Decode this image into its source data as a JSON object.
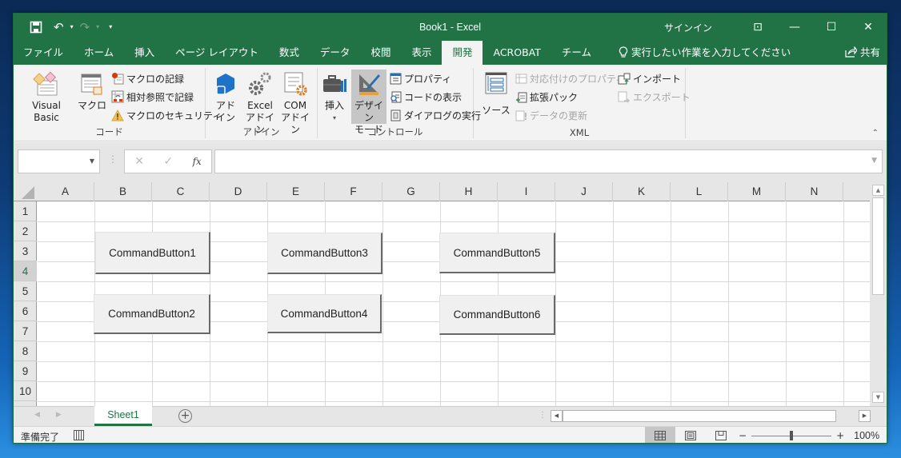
{
  "titlebar": {
    "title": "Book1  -  Excel",
    "signin": "サインイン",
    "qat": {
      "save": "save-icon",
      "undo": "undo-icon",
      "redo": "redo-icon",
      "customize": "customize-qat-icon"
    },
    "icons": {
      "save": "🖫",
      "undo": "↶",
      "redo": "↷",
      "dropdown": "▾",
      "customize": "⩡",
      "ribbon_options": "⊡",
      "minimize": "—",
      "maximize": "☐",
      "close": "✕"
    }
  },
  "tabs": [
    {
      "label": "ファイル"
    },
    {
      "label": "ホーム"
    },
    {
      "label": "挿入"
    },
    {
      "label": "ページ レイアウト"
    },
    {
      "label": "数式"
    },
    {
      "label": "データ"
    },
    {
      "label": "校閲"
    },
    {
      "label": "表示"
    },
    {
      "label": "開発",
      "active": true
    },
    {
      "label": "ACROBAT"
    },
    {
      "label": "チーム"
    }
  ],
  "tell_me": {
    "icon": "💡",
    "placeholder": "実行したい作業を入力してください"
  },
  "share": {
    "icon": "⇱",
    "label": "共有"
  },
  "ribbon": {
    "code": {
      "label": "コード",
      "visual_basic": "Visual Basic",
      "macros": "マクロ",
      "record_macro": "マクロの記録",
      "relative_refs": "相対参照で記録",
      "macro_security": "マクロのセキュリティ"
    },
    "addins": {
      "label": "アドイン",
      "addins_line1": "アド",
      "addins_line2": "イン",
      "excel_addins_line1": "Excel",
      "excel_addins_line2": "アドイン",
      "com_addins_line1": "COM",
      "com_addins_line2": "アドイン"
    },
    "controls": {
      "label": "コントロール",
      "insert": "挿入",
      "design_mode_line1": "デザイン",
      "design_mode_line2": "モード",
      "properties": "プロパティ",
      "view_code": "コードの表示",
      "run_dialog": "ダイアログの実行"
    },
    "xml": {
      "label": "XML",
      "source": "ソース",
      "map_properties": "対応付けのプロパティ",
      "expansion_packs": "拡張パック",
      "refresh_data": "データの更新",
      "import": "インポート",
      "export": "エクスポート"
    },
    "collapse_icon": "⌃"
  },
  "formula_bar": {
    "name_box_value": "",
    "cancel_icon": "✕",
    "enter_icon": "✓",
    "fx_label": "fx",
    "formula_value": ""
  },
  "grid": {
    "columns": [
      "A",
      "B",
      "C",
      "D",
      "E",
      "F",
      "G",
      "H",
      "I",
      "J",
      "K",
      "L",
      "M",
      "N"
    ],
    "rows": [
      "1",
      "2",
      "3",
      "4",
      "5",
      "6",
      "7",
      "8",
      "9",
      "10"
    ],
    "selected_row": "4"
  },
  "command_buttons": [
    {
      "label": "CommandButton1"
    },
    {
      "label": "CommandButton2"
    },
    {
      "label": "CommandButton3"
    },
    {
      "label": "CommandButton4"
    },
    {
      "label": "CommandButton5"
    },
    {
      "label": "CommandButton6"
    }
  ],
  "sheets": {
    "tabs": [
      {
        "label": "Sheet1",
        "active": true
      }
    ],
    "add_icon": "+",
    "prev_icon": "◀",
    "next_icon": "▶"
  },
  "status": {
    "text": "準備完了",
    "zoom": "100%",
    "zoom_minus": "−",
    "zoom_plus": "+",
    "views": {
      "normal": "▦",
      "page_layout": "▤",
      "page_break": "◫"
    }
  }
}
